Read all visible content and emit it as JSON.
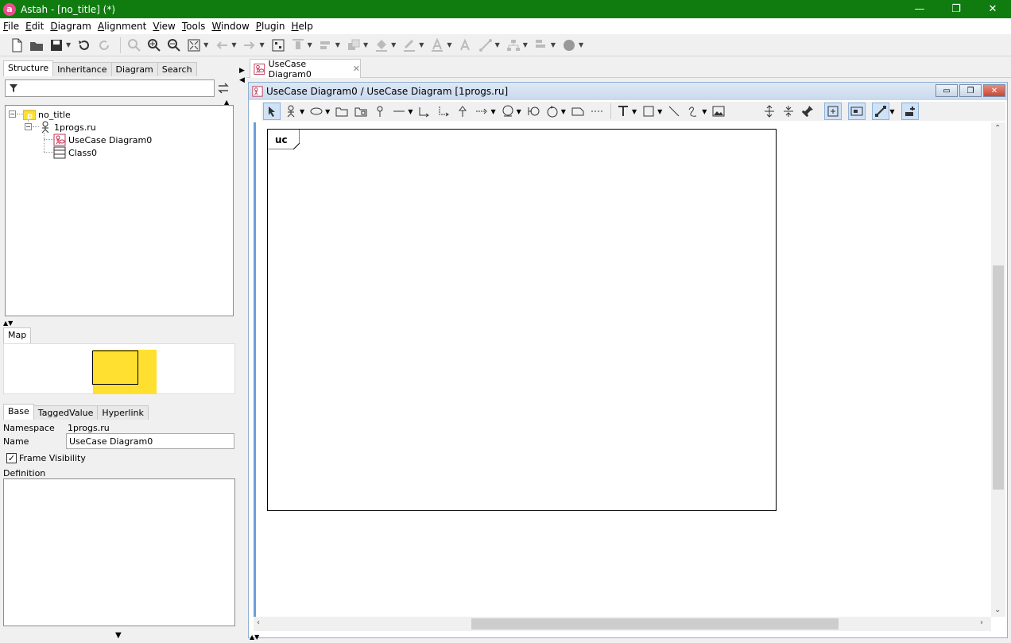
{
  "window": {
    "title": "Astah - [no_title] (*)",
    "app_icon_glyph": "a",
    "minimize": "—",
    "restore": "❐",
    "close": "✕"
  },
  "menu": [
    {
      "label": "File",
      "key": "F",
      "rest": "ile"
    },
    {
      "label": "Edit",
      "key": "E",
      "rest": "dit"
    },
    {
      "label": "Diagram",
      "key": "D",
      "rest": "iagram"
    },
    {
      "label": "Alignment",
      "key": "A",
      "rest": "lignment"
    },
    {
      "label": "View",
      "key": "V",
      "rest": "iew"
    },
    {
      "label": "Tools",
      "key": "T",
      "rest": "ools"
    },
    {
      "label": "Window",
      "key": "W",
      "rest": "indow"
    },
    {
      "label": "Plugin",
      "key": "P",
      "rest": "lugin"
    },
    {
      "label": "Help",
      "key": "H",
      "rest": "elp"
    }
  ],
  "left": {
    "tabs": [
      "Structure",
      "Inheritance",
      "Diagram",
      "Search"
    ],
    "active_tab": "Structure",
    "tree": {
      "root": "no_title",
      "package": "1progs.ru",
      "diagram": "UseCase Diagram0",
      "class": "Class0"
    },
    "map_tab": "Map",
    "prop_tabs": [
      "Base",
      "TaggedValue",
      "Hyperlink"
    ],
    "props": {
      "namespace_label": "Namespace",
      "namespace_value": "1progs.ru",
      "name_label": "Name",
      "name_value": "UseCase Diagram0",
      "frame_visibility_label": "Frame Visibility",
      "frame_visibility_checked": "✓",
      "definition_label": "Definition"
    },
    "collapse_glyph": "▼"
  },
  "right": {
    "doc_tab_label": "UseCase Diagram0",
    "doc_tab_close": "✕",
    "inner_title": "UseCase Diagram0 / UseCase Diagram [1progs.ru]",
    "frame_tag": "uc"
  },
  "colors": {
    "titlebar": "#107c10",
    "frame_tab_yellow": "#ffe030",
    "selection_blue": "#cfe2f7"
  }
}
